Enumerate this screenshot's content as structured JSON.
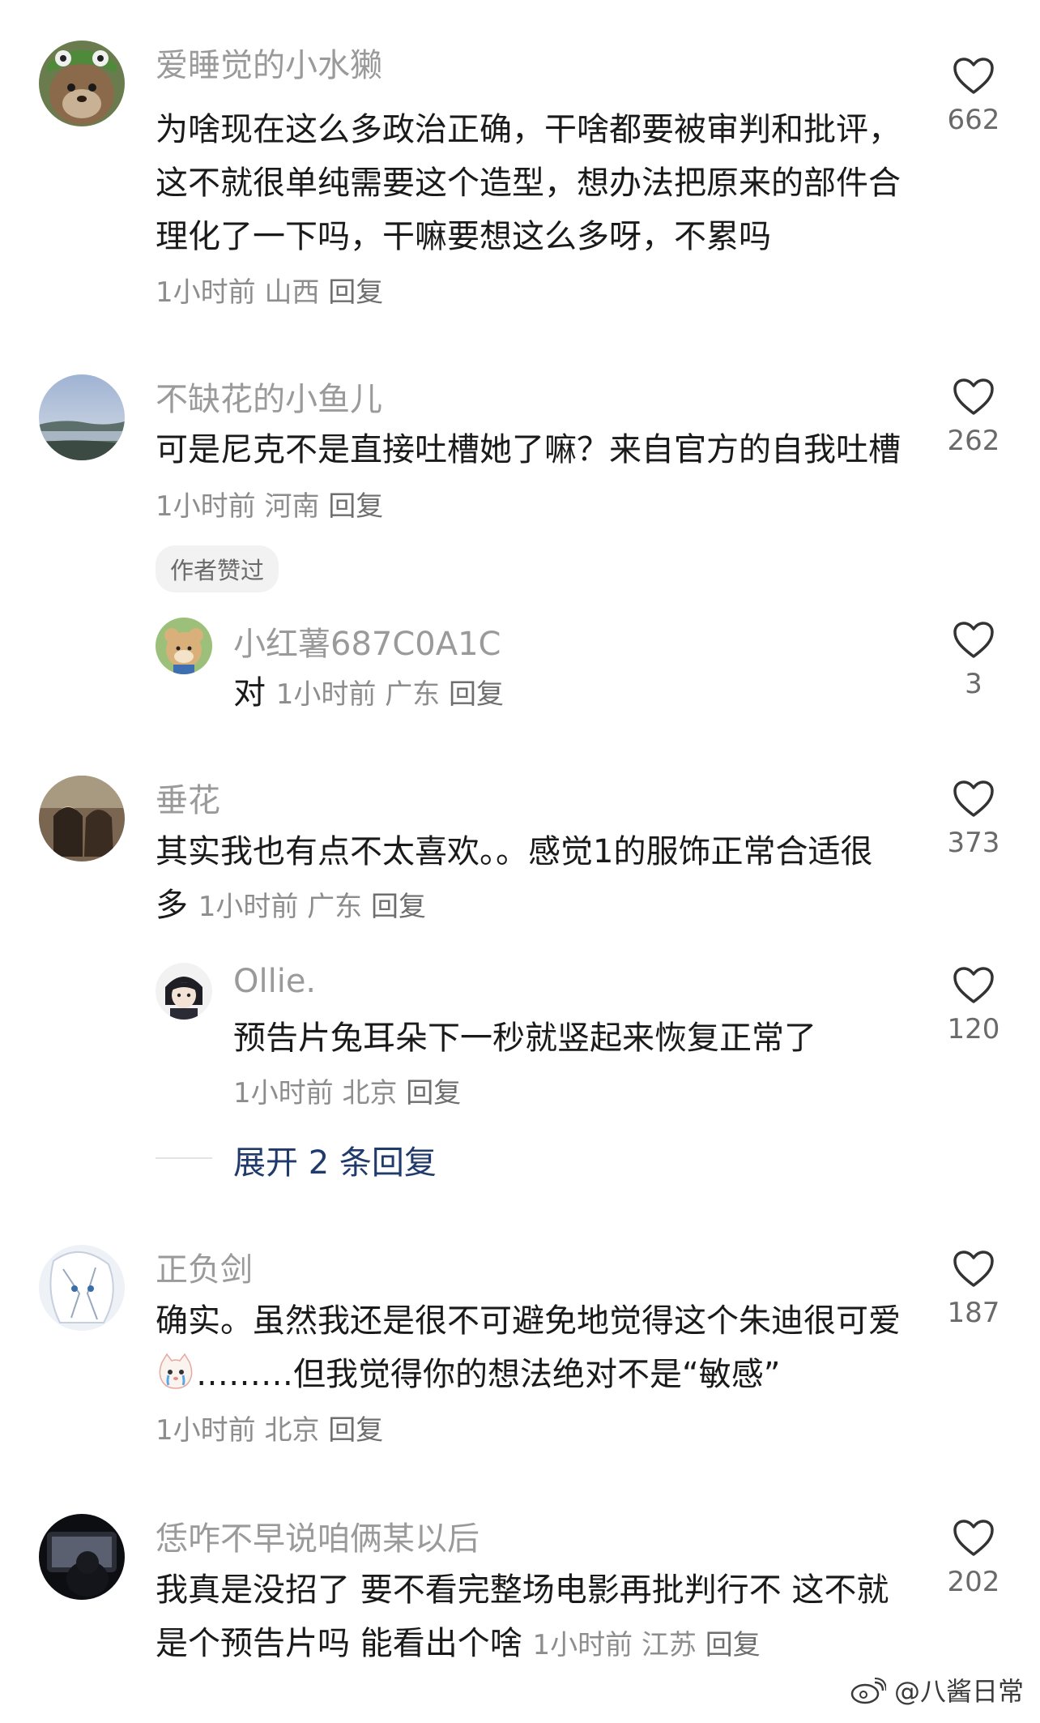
{
  "comments": [
    {
      "username": "爱睡觉的小水獭",
      "text": "为啥现在这么多政治正确，干啥都要被审判和批评，这不就很单纯需要这个造型，想办法把原来的部件合理化了一下吗，干嘛要想这么多呀，不累吗",
      "time": "1小时前",
      "location": "山西",
      "reply_label": "回复",
      "likes": "662"
    },
    {
      "username": "不缺花的小鱼儿",
      "text": "可是尼克不是直接吐槽她了嘛？来自官方的自我吐槽",
      "time": "1小时前",
      "location": "河南",
      "reply_label": "回复",
      "likes": "262",
      "badge": "作者赞过",
      "replies": [
        {
          "username": "小红薯687C0A1C",
          "text": "对",
          "time": "1小时前",
          "location": "广东",
          "reply_label": "回复",
          "likes": "3"
        }
      ]
    },
    {
      "username": "垂花",
      "text": "其实我也有点不太喜欢。。感觉1的服饰正常合适很多",
      "time": "1小时前",
      "location": "广东",
      "reply_label": "回复",
      "likes": "373",
      "replies": [
        {
          "username": "Ollie.",
          "text": "预告片兔耳朵下一秒就竖起来恢复正常了",
          "time": "1小时前",
          "location": "北京",
          "reply_label": "回复",
          "likes": "120"
        }
      ],
      "expand_label": "展开 2 条回复"
    },
    {
      "username": "正负剑",
      "text_part1": "确实。虽然我还是很不可避免地觉得这个朱迪很可爱",
      "text_part2": "………但我觉得你的想法绝对不是“敏感”",
      "time": "1小时前",
      "location": "北京",
      "reply_label": "回复",
      "likes": "187"
    },
    {
      "username": "恁咋不早说咱俩某以后",
      "text": "我真是没招了 要不看完整场电影再批判行不 这不就是个预告片吗 能看出个啥",
      "time": "1小时前",
      "location": "江苏",
      "reply_label": "回复",
      "likes": "202"
    }
  ],
  "watermark": "@八酱日常",
  "colors": {
    "accent": "#203b6b",
    "muted": "#9a9a9a"
  }
}
